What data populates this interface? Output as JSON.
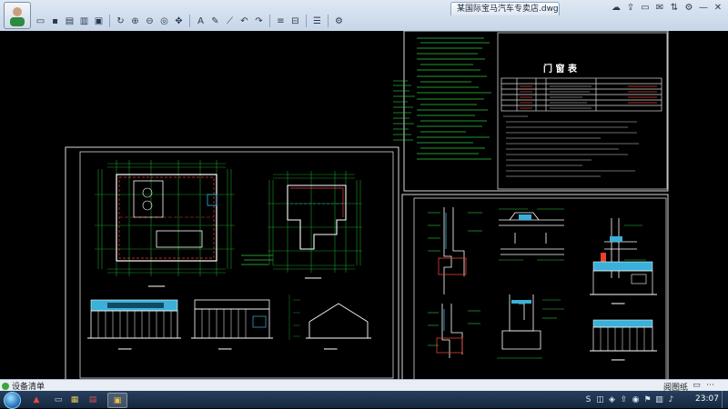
{
  "window": {
    "document_tab_title": "某国际宝马汽车专卖店.dwg"
  },
  "toolbar": {
    "buttons": [
      {
        "name": "open-file-button",
        "glyph": "▭"
      },
      {
        "name": "save-button",
        "glyph": "▪"
      },
      {
        "name": "print-button",
        "glyph": "▤"
      },
      {
        "name": "export-button",
        "glyph": "▥"
      },
      {
        "name": "lock-button",
        "glyph": "▣"
      },
      {
        "name": "rotate-button",
        "glyph": "↻"
      },
      {
        "name": "zoom-in-button",
        "glyph": "⊕"
      },
      {
        "name": "zoom-out-button",
        "glyph": "⊖"
      },
      {
        "name": "zoom-window-button",
        "glyph": "◎"
      },
      {
        "name": "pan-button",
        "glyph": "✥"
      },
      {
        "name": "text-button",
        "glyph": "A"
      },
      {
        "name": "pencil-button",
        "glyph": "✎"
      },
      {
        "name": "brush-button",
        "glyph": "⟋"
      },
      {
        "name": "undo-button",
        "glyph": "↶"
      },
      {
        "name": "redo-button",
        "glyph": "↷"
      },
      {
        "name": "layers-button",
        "glyph": "≡"
      },
      {
        "name": "measure-button",
        "glyph": "⊟"
      },
      {
        "name": "stack-button",
        "glyph": "☰"
      },
      {
        "name": "settings-button",
        "glyph": "⚙"
      }
    ]
  },
  "window_controls": [
    {
      "name": "cloud-icon",
      "glyph": "☁"
    },
    {
      "name": "share-icon",
      "glyph": "⇪"
    },
    {
      "name": "folder-icon",
      "glyph": "▭"
    },
    {
      "name": "message-icon",
      "glyph": "✉"
    },
    {
      "name": "pin-icon",
      "glyph": "⇅"
    },
    {
      "name": "gear-icon",
      "glyph": "⚙"
    },
    {
      "name": "minimize-icon",
      "glyph": "—"
    },
    {
      "name": "close-icon",
      "glyph": "✕"
    }
  ],
  "drawing": {
    "door_window_table_title": "门 窗 表"
  },
  "statusbar": {
    "left_label": "设备清单",
    "zoom_label": "阅图纸"
  },
  "taskbar": {
    "clock": "23:07"
  },
  "colors": {
    "drawing_line": "#ffffff",
    "annotation_green": "#2ecc40",
    "dimension_green": "#1a9a2a",
    "wall_red": "#e8412e",
    "roof_blue": "#3bb0d8",
    "frame_white": "#d9d9d9"
  }
}
